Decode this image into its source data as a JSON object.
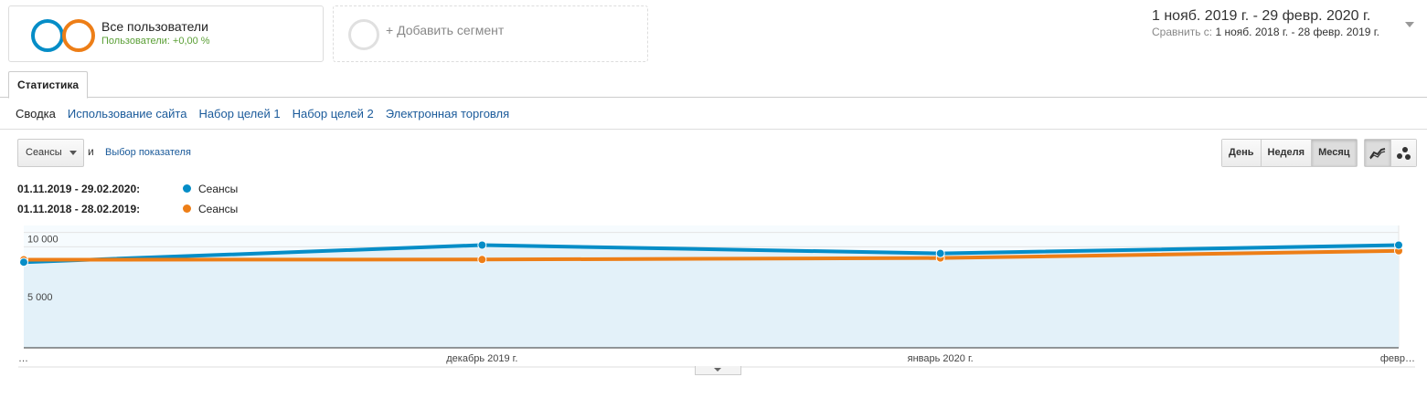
{
  "segment": {
    "title": "Все пользователи",
    "subtitle": "Пользователи: +0,00 %",
    "colors": [
      "#058dc7",
      "#ed7e17"
    ]
  },
  "add_segment": {
    "label": "+ Добавить сегмент"
  },
  "date_range": {
    "main": "1 нояб. 2019 г. - 29 февр. 2020 г.",
    "compare_prefix": "Сравнить с:",
    "compare_value": "1 нояб. 2018 г. - 28 февр. 2019 г."
  },
  "tabs": [
    {
      "label": "Статистика",
      "active": true
    }
  ],
  "subnav": [
    "Сводка",
    "Использование сайта",
    "Набор целей 1",
    "Набор целей 2",
    "Электронная торговля"
  ],
  "controls": {
    "metric": "Сеансы",
    "and": "и",
    "choose_metric": "Выбор показателя",
    "periods": [
      "День",
      "Неделя",
      "Месяц"
    ],
    "active_period": "Месяц",
    "chart_types": [
      "line-chart-icon",
      "motion-chart-icon"
    ]
  },
  "legend": [
    {
      "range": "01.11.2019 - 29.02.2020:",
      "name": "Сеансы",
      "color": "#058dc7"
    },
    {
      "range": "01.11.2018 - 28.02.2019:",
      "name": "Сеансы",
      "color": "#ed7e17"
    }
  ],
  "chart_data": {
    "type": "line",
    "x": [
      "…",
      "декабрь 2019 г.",
      "январь 2020 г.",
      "февр…"
    ],
    "series": [
      {
        "name": "Сеансы",
        "period": "01.11.2019 - 29.02.2020",
        "color": "#058dc7",
        "values": [
          7420,
          8900,
          8180,
          8900
        ]
      },
      {
        "name": "Сеансы",
        "period": "01.11.2018 - 28.02.2019",
        "color": "#ed7e17",
        "values": [
          7630,
          7650,
          7780,
          8400
        ]
      }
    ],
    "yticks": [
      {
        "value": 10000,
        "label": "10 000"
      },
      {
        "value": 5000,
        "label": "5 000"
      }
    ],
    "ylim": [
      0,
      10600
    ],
    "grid": true,
    "area_fill_series": 0
  }
}
